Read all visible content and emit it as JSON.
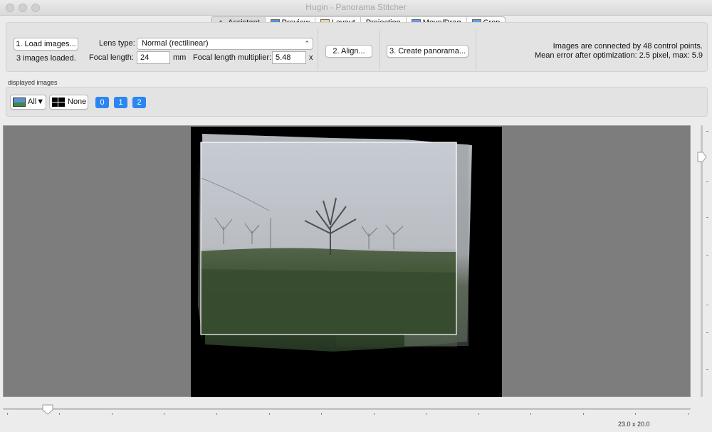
{
  "window": {
    "title": "Hugin - Panorama Stitcher"
  },
  "tabs": [
    {
      "label": "Assistant",
      "icon": "assistant-icon",
      "active": true
    },
    {
      "label": "Preview",
      "icon": "preview-icon"
    },
    {
      "label": "Layout",
      "icon": "layout-icon"
    },
    {
      "label": "Projection"
    },
    {
      "label": "Move/Drag",
      "icon": "move-drag-icon"
    },
    {
      "label": "Crop",
      "icon": "crop-icon"
    }
  ],
  "assistant": {
    "load_button": "1. Load images...",
    "images_loaded": "3 images loaded.",
    "lens_type_label": "Lens type:",
    "lens_type_value": "Normal (rectilinear)",
    "focal_length_label": "Focal length:",
    "focal_length_value": "24",
    "focal_length_unit": "mm",
    "multiplier_label": "Focal length multiplier:",
    "multiplier_value": "5.48",
    "multiplier_unit": "x",
    "align_button": "2. Align...",
    "create_button": "3. Create panorama...",
    "status_line1": "Images are connected by 48 control points.",
    "status_line2": "Mean error after optimization: 2.5 pixel, max: 5.9"
  },
  "displayed_images": {
    "label": "displayed images",
    "all_button": "All▼",
    "none_button": "None",
    "image_buttons": [
      "0",
      "1",
      "2"
    ]
  },
  "status_bar": {
    "fov": "23.0 x 20.0"
  },
  "colors": {
    "accent": "#2b86f0",
    "preview_bg": "#7d7d7d",
    "canvas_bg": "#000000"
  }
}
